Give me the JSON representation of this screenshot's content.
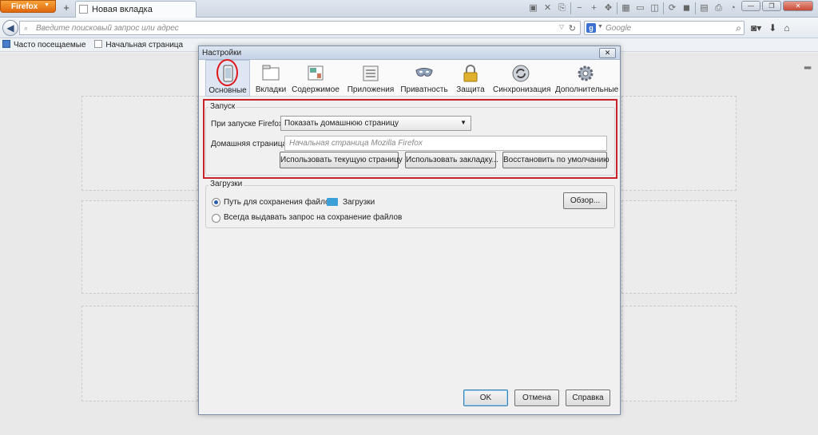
{
  "browser": {
    "app_button": "Firefox",
    "tab_title": "Новая вкладка",
    "url_placeholder": "Введите поисковый запрос или адрес",
    "search_placeholder": "Google",
    "bookmarks": [
      "Часто посещаемые",
      "Начальная страница"
    ]
  },
  "dialog": {
    "title": "Настройки",
    "panes": [
      "Основные",
      "Вкладки",
      "Содержимое",
      "Приложения",
      "Приватность",
      "Защита",
      "Синхронизация",
      "Дополнительные"
    ],
    "selected_pane": "Основные",
    "startup": {
      "legend": "Запуск",
      "when_start_label": "При запуске Firefox:",
      "when_start_value": "Показать домашнюю страницу",
      "home_label": "Домашняя страница:",
      "home_placeholder": "Начальная страница Mozilla Firefox",
      "btn_use_current": "Использовать текущую страницу",
      "btn_use_bookmark": "Использовать закладку...",
      "btn_restore": "Восстановить по умолчанию"
    },
    "downloads": {
      "legend": "Загрузки",
      "save_path_label": "Путь для сохранения файлов",
      "folder_name": "Загрузки",
      "browse_button": "Обзор...",
      "always_ask_label": "Всегда выдавать запрос на сохранение файлов"
    },
    "buttons": {
      "ok": "OK",
      "cancel": "Отмена",
      "help": "Справка"
    }
  },
  "colors": {
    "highlight": "#c8232b",
    "firefox_orange": "#e8740f"
  }
}
